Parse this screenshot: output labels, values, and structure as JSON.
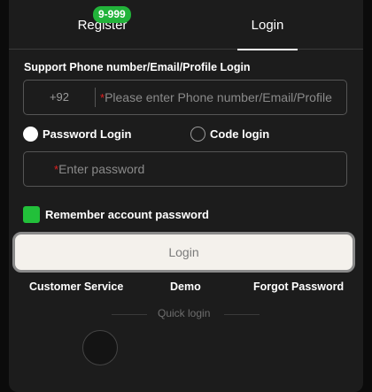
{
  "tabs": {
    "register": "Register",
    "register_badge": "9-999",
    "login": "Login",
    "active": "Login"
  },
  "form": {
    "support_label": "Support Phone number/Email/Profile Login",
    "country_code": "+92",
    "required_mark": "*",
    "account_placeholder": "Please enter Phone number/Email/Profile",
    "login_modes": [
      {
        "label": "Password Login",
        "selected": true
      },
      {
        "label": "Code login",
        "selected": false
      }
    ],
    "password_placeholder": "Enter password",
    "remember_label": "Remember account password",
    "remember_checked": true,
    "login_button": "Login"
  },
  "footer_links": {
    "customer_service": "Customer Service",
    "demo": "Demo",
    "forgot_password": "Forgot Password"
  },
  "quick_login": {
    "label": "Quick login"
  },
  "colors": {
    "background": "#1c1c1c",
    "accent_green": "#22c03a",
    "required_red": "#e02020",
    "button_bg": "#f4f1ec"
  }
}
